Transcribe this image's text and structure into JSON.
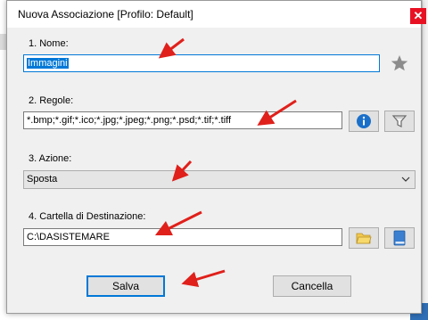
{
  "dialog": {
    "title": "Nuova Associazione [Profilo: Default]",
    "close_glyph": "✕"
  },
  "nome": {
    "label": "1. Nome:",
    "value": "Immagini",
    "star_icon": "star-icon"
  },
  "regole": {
    "label": "2. Regole:",
    "value": "*.bmp;*.gif;*.ico;*.jpg;*.jpeg;*.png;*.psd;*.tif;*.tiff",
    "info_icon": "info-icon",
    "filter_icon": "filter-icon"
  },
  "azione": {
    "label": "3. Azione:",
    "selected": "Sposta"
  },
  "destinazione": {
    "label": "4. Cartella di Destinazione:",
    "value": "C:\\DASISTEMARE",
    "folder_icon": "folder-icon",
    "book_icon": "book-icon"
  },
  "buttons": {
    "save": "Salva",
    "cancel": "Cancella"
  },
  "annotation_color": "#e0201b",
  "accent": "#0078d7"
}
